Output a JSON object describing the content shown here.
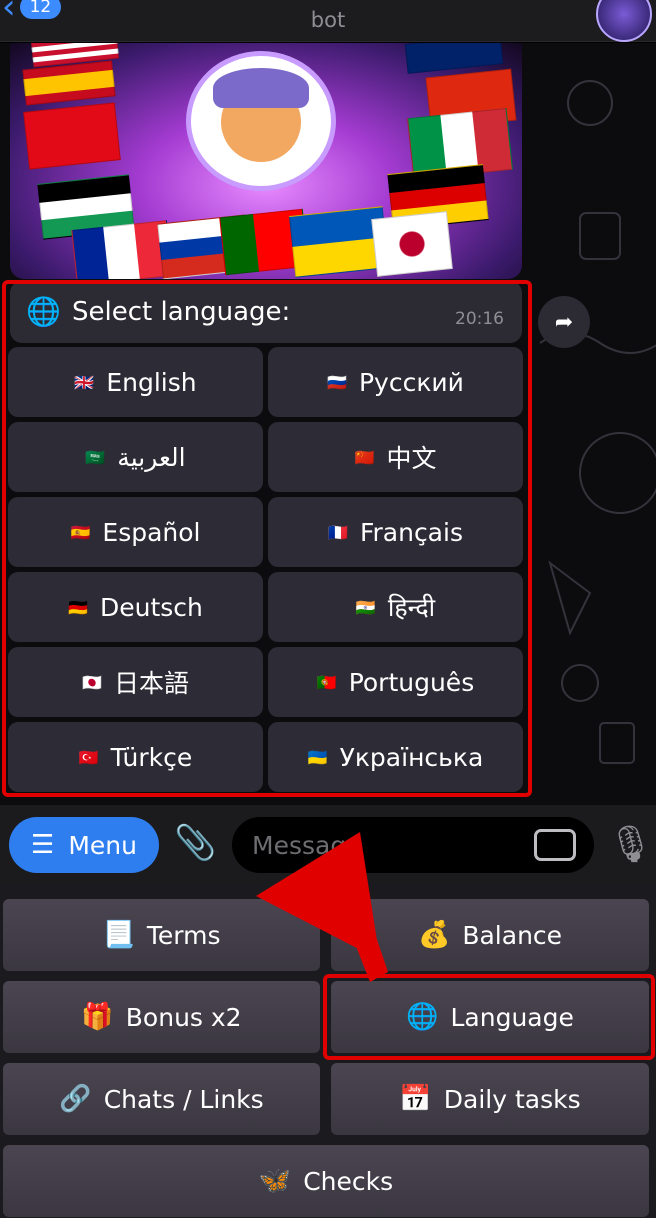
{
  "header": {
    "back_count": "12",
    "subtitle": "bot"
  },
  "message": {
    "icon": "globe-icon",
    "text": "Select language:",
    "time": "20:16"
  },
  "languages": [
    {
      "flag": "gb-flag-icon",
      "label": "English"
    },
    {
      "flag": "ru-flag-icon",
      "label": "Русский"
    },
    {
      "flag": "sa-flag-icon",
      "label": "العربية"
    },
    {
      "flag": "cn-flag-icon",
      "label": "中文"
    },
    {
      "flag": "es-flag-icon",
      "label": "Español"
    },
    {
      "flag": "fr-flag-icon",
      "label": "Français"
    },
    {
      "flag": "de-flag-icon",
      "label": "Deutsch"
    },
    {
      "flag": "in-flag-icon",
      "label": "हिन्दी"
    },
    {
      "flag": "jp-flag-icon",
      "label": "日本語"
    },
    {
      "flag": "pt-flag-icon",
      "label": "Português"
    },
    {
      "flag": "tr-flag-icon",
      "label": "Türkçe"
    },
    {
      "flag": "ua-flag-icon",
      "label": "Українська"
    }
  ],
  "input_bar": {
    "menu_label": "Menu",
    "placeholder": "Message"
  },
  "reply_keyboard": {
    "terms": "Terms",
    "balance": "Balance",
    "bonus": "Bonus x2",
    "language": "Language",
    "chats": "Chats / Links",
    "daily": "Daily tasks",
    "checks": "Checks"
  },
  "colors": {
    "accent": "#2e7ef0",
    "highlight": "#e00000"
  }
}
